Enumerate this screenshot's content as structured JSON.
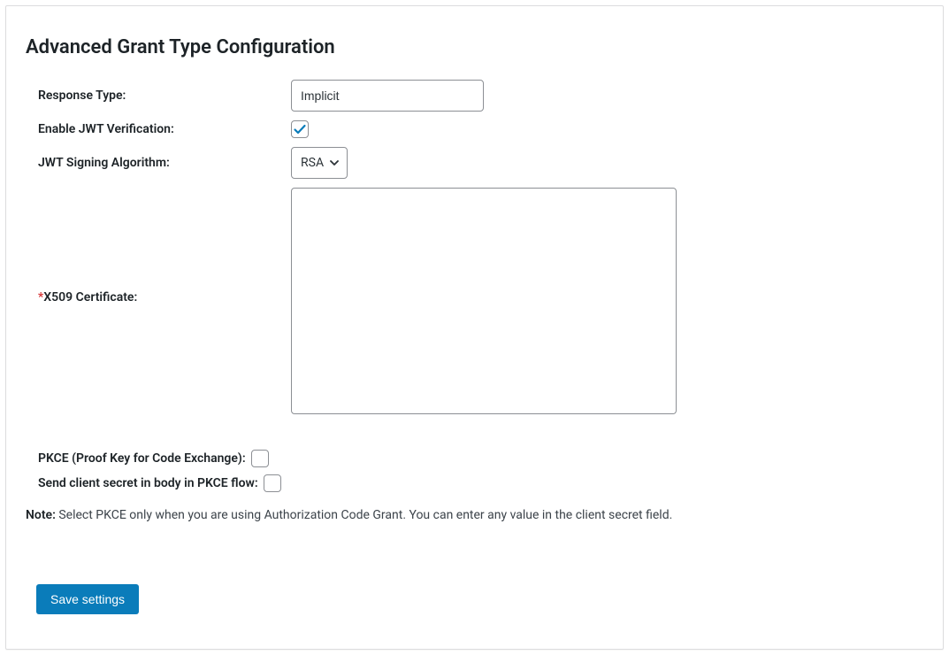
{
  "title": "Advanced Grant Type Configuration",
  "fields": {
    "response_type": {
      "label": "Response Type:",
      "value": "Implicit"
    },
    "jwt_verification": {
      "label": "Enable JWT Verification:",
      "checked": true
    },
    "signing_algo": {
      "label": "JWT Signing Algorithm:",
      "value": "RSA"
    },
    "x509": {
      "label": "X509 Certificate:",
      "value": ""
    },
    "pkce": {
      "label": "PKCE (Proof Key for Code Exchange):",
      "checked": false
    },
    "pkce_secret_body": {
      "label": "Send client secret in body in PKCE flow:",
      "checked": false
    }
  },
  "note_prefix": "Note:",
  "note_text": " Select PKCE only when you are using Authorization Code Grant. You can enter any value in the client secret field.",
  "save_label": "Save settings",
  "required_marker": "*"
}
